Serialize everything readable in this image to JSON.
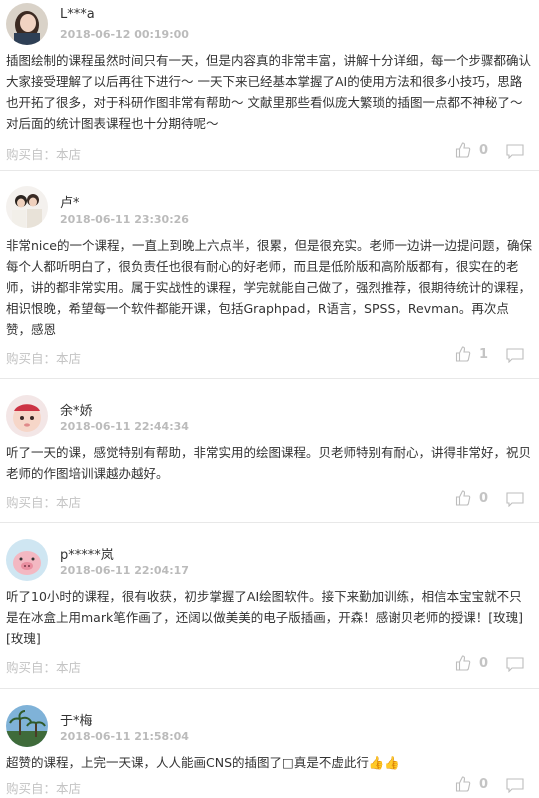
{
  "reviews": [
    {
      "user": "L***a",
      "date": "2018-06-12 00:19:00",
      "avatar": "avatar-woman-photo",
      "content": "插图绘制的课程虽然时间只有一天，但是内容真的非常丰富，讲解十分详细，每一个步骤都确认大家接受理解了以后再往下进行～ 一天下来已经基本掌握了AI的使用方法和很多小技巧，思路也开拓了很多，对于科研作图非常有帮助～ 文献里那些看似庞大繁琐的插图一点都不神秘了～ 对后面的统计图表课程也十分期待呢～",
      "source": "购买自：本店",
      "likes": "0"
    },
    {
      "user": "卢*",
      "date": "2018-06-11 23:30:26",
      "avatar": "avatar-couple-photo",
      "content": "非常nice的一个课程，一直上到晚上六点半，很累，但是很充实。老师一边讲一边提问题，确保每个人都听明白了，很负责任也很有耐心的好老师，而且是低阶版和高阶版都有，很实在的老师，讲的都非常实用。属于实战性的课程，学完就能自己做了，强烈推荐，很期待统计的课程，相识恨晚，希望每一个软件都能开课，包括Graphpad，R语言，SPSS，Revman。再次点赞，感恩",
      "source": "购买自：本店",
      "likes": "1"
    },
    {
      "user": "余*娇",
      "date": "2018-06-11 22:44:34",
      "avatar": "avatar-baby-photo",
      "content": "听了一天的课，感觉特别有帮助，非常实用的绘图课程。贝老师特别有耐心，讲得非常好，祝贝老师的作图培训课越办越好。",
      "source": "购买自：本店",
      "likes": "0"
    },
    {
      "user": "p*****岚",
      "date": "2018-06-11 22:04:17",
      "avatar": "avatar-cartoon-pig",
      "content": "听了10小时的课程，很有收获，初步掌握了AI绘图软件。接下来勤加训练，相信本宝宝就不只是在冰盒上用mark笔作画了，还阔以做美美的电子版插画，开森！感谢贝老师的授课！[玫瑰][玫瑰]",
      "source": "购买自：本店",
      "likes": "0"
    },
    {
      "user": "于*梅",
      "date": "2018-06-11 21:58:04",
      "avatar": "avatar-palm-landscape",
      "content": "超赞的课程，上完一天课，人人能画CNS的插图了□真是不虚此行👍👍",
      "source": "购买自：本店",
      "likes": "0"
    }
  ],
  "icons": {
    "like": "thumbs-up-icon",
    "comment": "comment-bubble-icon"
  },
  "colors": {
    "muted": "#c4c4c4",
    "date": "#bbbbbb",
    "text": "#333333",
    "divider": "#e8e8e8"
  }
}
